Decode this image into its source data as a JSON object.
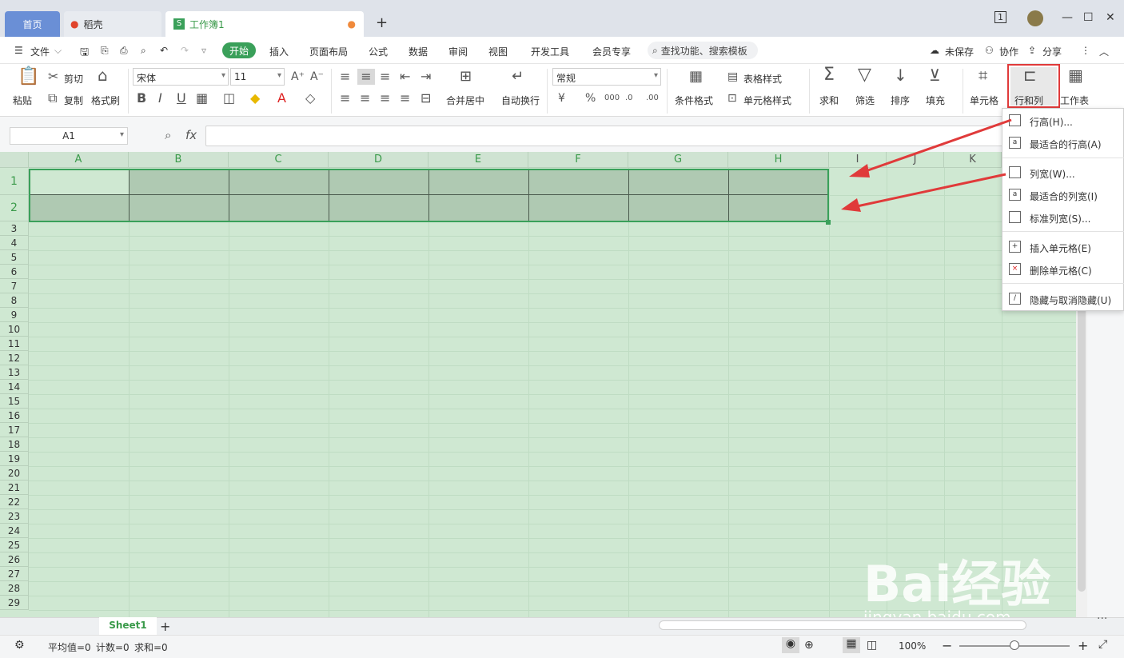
{
  "tabs": {
    "home": "首页",
    "daoke": "稻壳",
    "workbook": "工作簿1",
    "new_tab": "+"
  },
  "window": {
    "counter": "1",
    "minimize": "—",
    "maximize": "☐",
    "close": "✕"
  },
  "menubar": {
    "file": "文件",
    "start": "开始",
    "items": [
      "插入",
      "页面布局",
      "公式",
      "数据",
      "审阅",
      "视图",
      "开发工具",
      "会员专享"
    ],
    "search": "查找功能、搜索模板",
    "unsaved": "未保存",
    "collab": "协作",
    "share": "分享"
  },
  "ribbon": {
    "paste": "粘贴",
    "cut": "剪切",
    "copy": "复制",
    "format_painter": "格式刷",
    "font_name": "宋体",
    "font_size": "11",
    "merge": "合并居中",
    "wrap": "自动换行",
    "number_format": "常规",
    "cond_format": "条件格式",
    "table_style": "表格样式",
    "cell_style": "单元格样式",
    "sum": "求和",
    "filter": "筛选",
    "sort": "排序",
    "fill": "填充",
    "cell": "单元格",
    "rowcol": "行和列",
    "worksheet": "工作表"
  },
  "formula": {
    "cell_ref": "A1",
    "fx": "fx"
  },
  "columns": [
    "A",
    "B",
    "C",
    "D",
    "E",
    "F",
    "G",
    "H",
    "I",
    "J",
    "K"
  ],
  "rows": [
    "1",
    "2",
    "3",
    "4",
    "5",
    "6",
    "7",
    "8",
    "9",
    "10",
    "11",
    "12",
    "13",
    "14",
    "15",
    "16",
    "17",
    "18",
    "19",
    "20",
    "21",
    "22",
    "23",
    "24",
    "25",
    "26",
    "27",
    "28",
    "29"
  ],
  "dropdown_menu": [
    {
      "label": "行高(H)...",
      "icon": "row-height-icon"
    },
    {
      "label": "最适合的行高(A)",
      "icon": "autofit-row-icon"
    },
    {
      "label": "列宽(W)...",
      "icon": "col-width-icon"
    },
    {
      "label": "最适合的列宽(I)",
      "icon": "autofit-col-icon"
    },
    {
      "label": "标准列宽(S)...",
      "icon": "standard-width-icon"
    },
    {
      "label": "插入单元格(E)",
      "icon": "insert-cell-icon"
    },
    {
      "label": "删除单元格(C)",
      "icon": "delete-cell-icon"
    },
    {
      "label": "隐藏与取消隐藏(U)",
      "icon": "hide-unhide-icon"
    }
  ],
  "sheets": {
    "active": "Sheet1",
    "add": "+"
  },
  "status": {
    "average": "平均值=0",
    "count": "计数=0",
    "sum": "求和=0",
    "zoom": "100%"
  },
  "watermark": {
    "brand": "Bai经验",
    "url": "jingyan.baidu.com"
  },
  "colors": {
    "accent": "#3aa05a",
    "highlight": "#e03a3a",
    "grid_bg": "#cfe8d2"
  }
}
